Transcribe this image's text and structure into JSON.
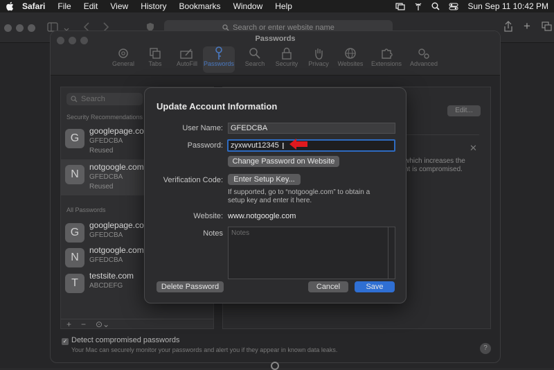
{
  "menubar": {
    "items": [
      "Safari",
      "File",
      "Edit",
      "View",
      "History",
      "Bookmarks",
      "Window",
      "Help"
    ],
    "clock": "Sun Sep 11  10:42 PM"
  },
  "safari": {
    "address_placeholder": "Search or enter website name"
  },
  "prefs": {
    "title": "Passwords",
    "tabs": [
      {
        "label": "General",
        "icon": "gear-icon"
      },
      {
        "label": "Tabs",
        "icon": "tabs-icon"
      },
      {
        "label": "AutoFill",
        "icon": "autofill-icon"
      },
      {
        "label": "Passwords",
        "icon": "key-icon"
      },
      {
        "label": "Search",
        "icon": "search-icon"
      },
      {
        "label": "Security",
        "icon": "lock-icon"
      },
      {
        "label": "Privacy",
        "icon": "hand-icon"
      },
      {
        "label": "Websites",
        "icon": "globe-icon"
      },
      {
        "label": "Extensions",
        "icon": "puzzle-icon"
      },
      {
        "label": "Advanced",
        "icon": "gears-icon"
      }
    ],
    "active_tab": "Passwords",
    "sidebar": {
      "search_placeholder": "Search",
      "section_security": "Security Recommendations",
      "security_items": [
        {
          "initial": "G",
          "site": "googlepage.com",
          "user": "GFEDCBA",
          "status": "Reused"
        },
        {
          "initial": "N",
          "site": "notgoogle.com",
          "user": "GFEDCBA",
          "status": "Reused"
        }
      ],
      "section_all": "All Passwords",
      "all_items": [
        {
          "initial": "G",
          "site": "googlepage.com",
          "user": "GFEDCBA"
        },
        {
          "initial": "N",
          "site": "notgoogle.com",
          "user": "GFEDCBA"
        },
        {
          "initial": "T",
          "site": "testsite.com",
          "user": "ABCDEFG"
        }
      ],
      "footer": {
        "add": "+",
        "remove": "−",
        "more": "⊙⌄"
      }
    },
    "detail": {
      "edit_label": "Edit...",
      "warning_text": "which increases the\nnt is compromised."
    },
    "detect": {
      "label": "Detect compromised passwords",
      "sub": "Your Mac can securely monitor your passwords and alert you if they appear in known data leaks."
    },
    "help": "?"
  },
  "modal": {
    "title": "Update Account Information",
    "username_label": "User Name:",
    "username_value": "GFEDCBA",
    "password_label": "Password:",
    "password_value": "zyxwvut12345",
    "change_password_label": "Change Password on Website",
    "verification_label": "Verification Code:",
    "setup_key_label": "Enter Setup Key...",
    "setup_note": "If supported, go to “notgoogle.com” to obtain a setup key and enter it here.",
    "website_label": "Website:",
    "website_value": "www.notgoogle.com",
    "notes_label": "Notes",
    "notes_placeholder": "Notes",
    "delete_label": "Delete Password",
    "cancel_label": "Cancel",
    "save_label": "Save"
  },
  "colors": {
    "accent": "#2f6fd3",
    "annotation_arrow": "#e0191f"
  }
}
